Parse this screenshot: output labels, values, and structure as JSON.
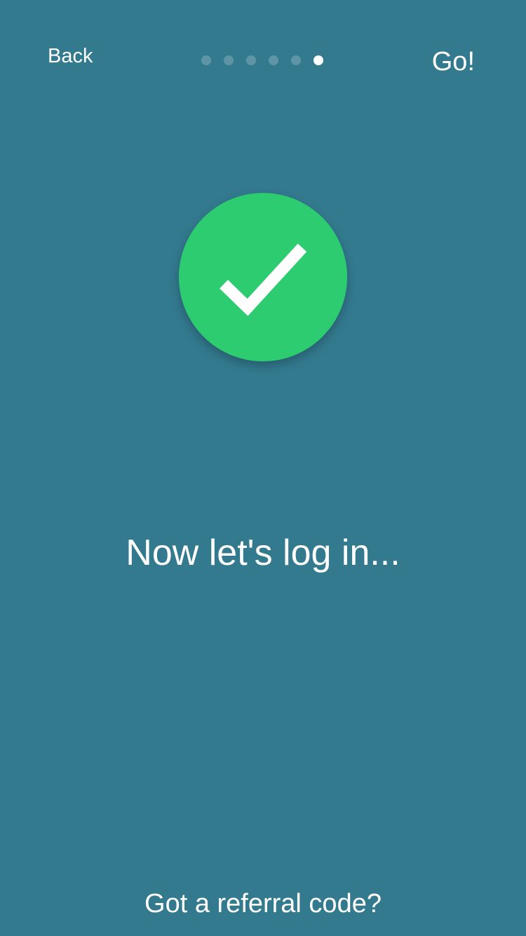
{
  "nav": {
    "back_label": "Back",
    "go_label": "Go!"
  },
  "pager": {
    "total_pages": 6,
    "current_page": 6,
    "active_color": "#ffffff",
    "inactive_color": "#5e95a6"
  },
  "badge": {
    "icon": "checkmark-icon",
    "color": "#2ecc71"
  },
  "main": {
    "headline": "Now let's log in..."
  },
  "footer": {
    "referral_label": "Got a referral code?"
  },
  "colors": {
    "background": "#337a8f",
    "text": "#ffffff",
    "success": "#2ecc71"
  }
}
